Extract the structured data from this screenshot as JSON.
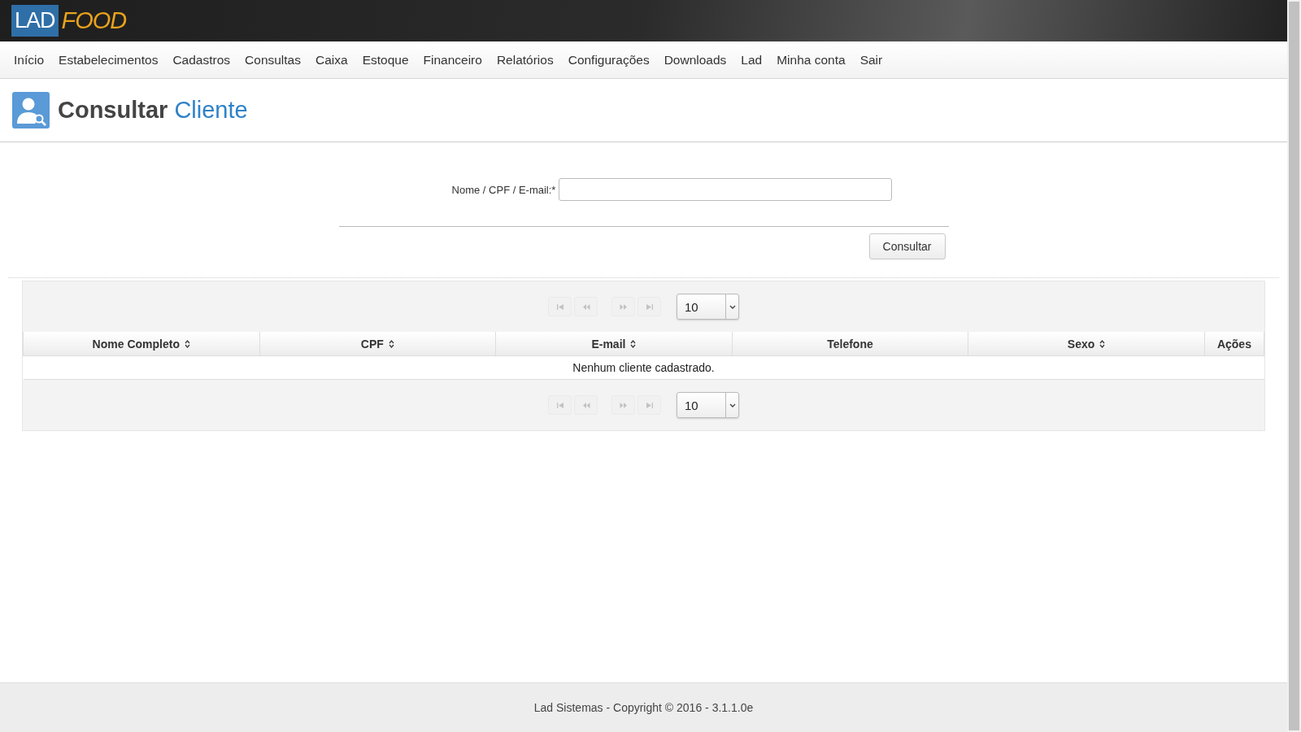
{
  "logo": {
    "part_1": "LAD",
    "part_2": "FOOD"
  },
  "nav": [
    "Início",
    "Estabelecimentos",
    "Cadastros",
    "Consultas",
    "Caixa",
    "Estoque",
    "Financeiro",
    "Relatórios",
    "Configurações",
    "Downloads",
    "Lad",
    "Minha conta",
    "Sair"
  ],
  "page_title": {
    "verb": "Consultar",
    "noun": "Cliente"
  },
  "search_form": {
    "label": "Nome / CPF / E-mail:*",
    "button": "Consultar"
  },
  "pager_top": {
    "disabled": true,
    "page_size": "10"
  },
  "table": {
    "columns": [
      {
        "label": "Nome Completo",
        "sortable": true
      },
      {
        "label": "CPF",
        "sortable": true
      },
      {
        "label": "E-mail",
        "sortable": true
      },
      {
        "label": "Telefone",
        "sortable": false
      },
      {
        "label": "Sexo",
        "sortable": true
      },
      {
        "label": "Ações",
        "sortable": false
      }
    ],
    "empty_message": "Nenhum cliente cadastrado."
  },
  "pager_bottom": {
    "disabled": true,
    "page_size": "10"
  },
  "footer": "Lad Sistemas - Copyright © 2016 - 3.1.1.0e"
}
